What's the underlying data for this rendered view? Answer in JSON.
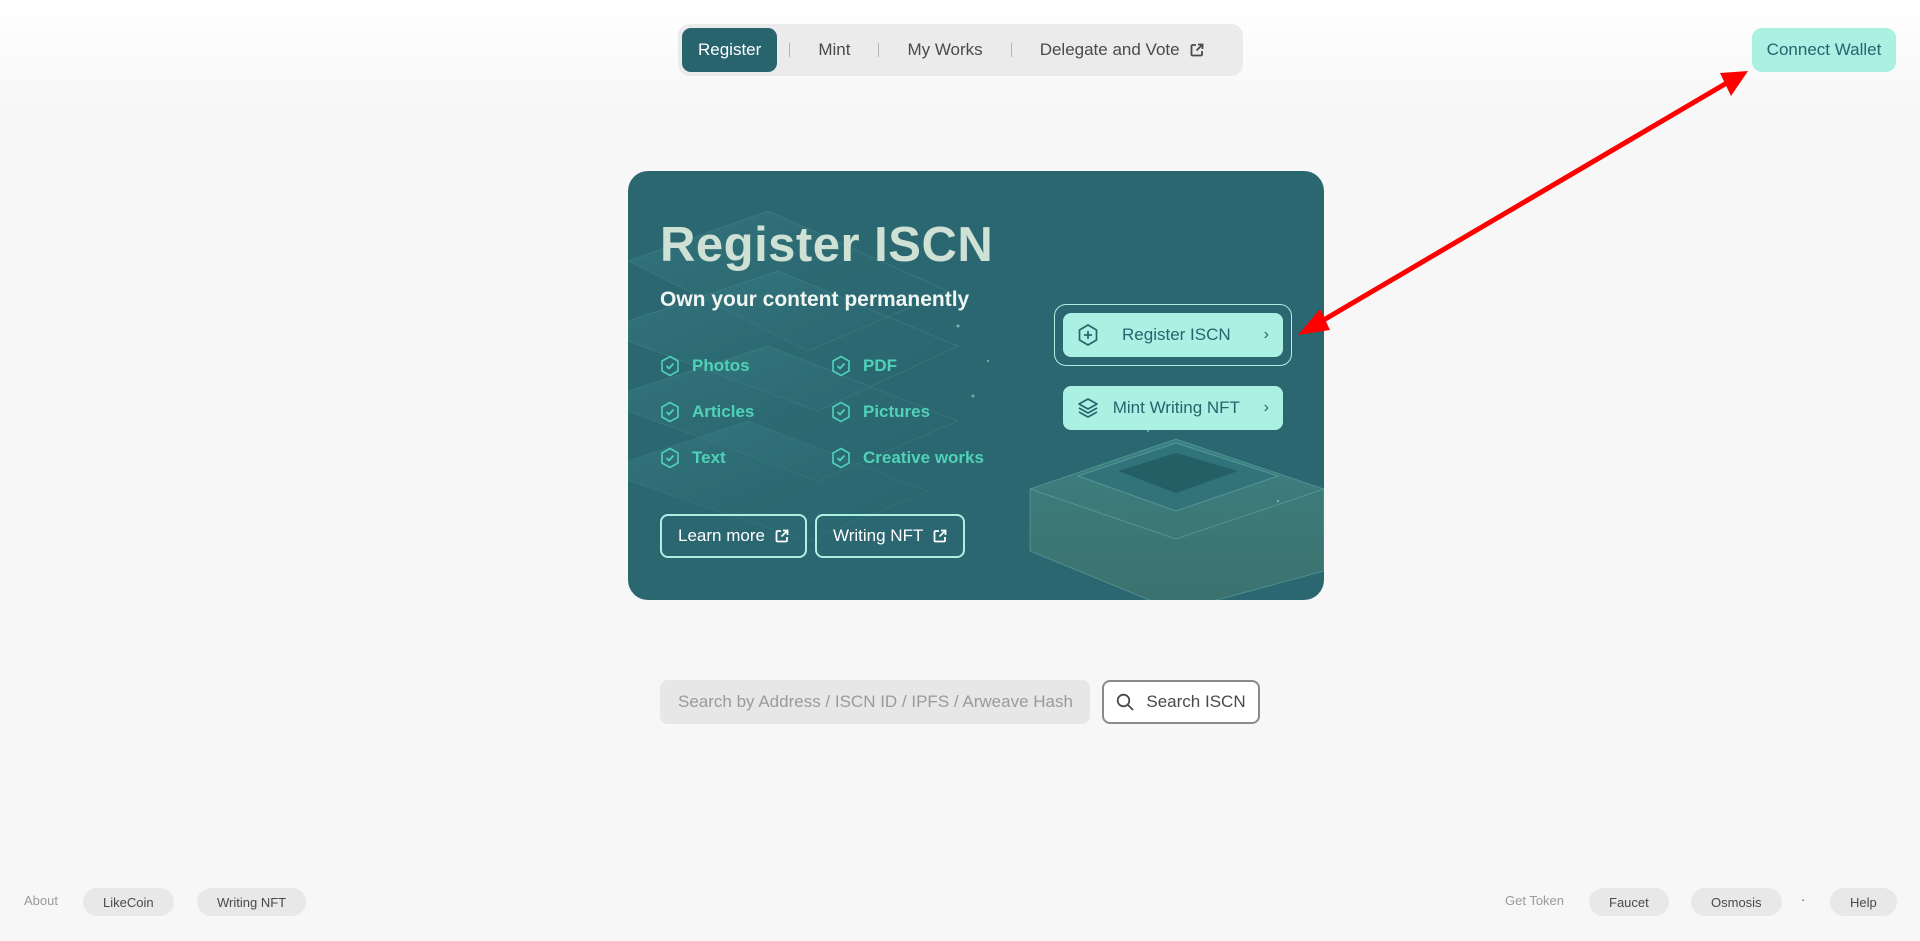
{
  "nav": {
    "items": [
      {
        "label": "Register"
      },
      {
        "label": "Mint"
      },
      {
        "label": "My Works"
      },
      {
        "label": "Delegate and Vote"
      }
    ]
  },
  "header": {
    "connect_wallet": "Connect Wallet"
  },
  "card": {
    "title": "Register ISCN",
    "subtitle": "Own your content permanently",
    "features": [
      "Photos",
      "PDF",
      "Articles",
      "Pictures",
      "Text",
      "Creative works"
    ],
    "links": [
      "Learn more",
      "Writing NFT"
    ],
    "actions": [
      "Register ISCN",
      "Mint Writing NFT"
    ]
  },
  "search": {
    "placeholder": "Search by Address / ISCN ID / IPFS / Arweave Hash",
    "button": "Search ISCN"
  },
  "footer": {
    "about_label": "About",
    "about_links": [
      "LikeCoin",
      "Writing NFT"
    ],
    "token_label": "Get Token",
    "token_links": [
      "Faucet",
      "Osmosis"
    ],
    "separator": "·",
    "help": "Help"
  },
  "colors": {
    "primary": "#28646e",
    "accent": "#aaf0e3",
    "feature_text": "#50d2b8",
    "annotation": "#ff0000"
  },
  "icons": [
    "external-link-icon",
    "check-hexagon-icon",
    "plus-hexagon-icon",
    "layers-icon",
    "chevron-right-icon",
    "search-icon"
  ]
}
